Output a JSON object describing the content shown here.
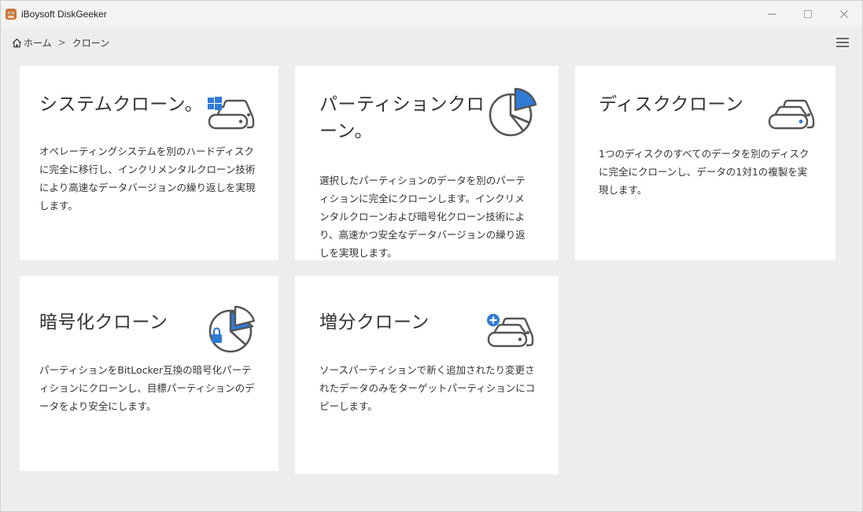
{
  "window": {
    "title": "iBoysoft DiskGeeker"
  },
  "breadcrumb": {
    "home": "ホーム",
    "separator": ">",
    "current": "クローン"
  },
  "colors": {
    "accent": "#2f7bd6",
    "icon_stroke": "#555555"
  },
  "cards": [
    {
      "title": "システムクローン。",
      "description": "オペレーティングシステムを別のハードディスクに完全に移行し、インクリメンタルクローン技術により高速なデータバージョンの繰り返しを実現します。",
      "icon": "windows-disk-icon"
    },
    {
      "title": "パーティションクローン。",
      "description": "選択したパーティションのデータを別のパーティションに完全にクローンします。インクリメンタルクローンおよび暗号化クローン技術により、高速かつ安全なデータバージョンの繰り返しを実現します。",
      "icon": "partition-pie-icon"
    },
    {
      "title": "ディスククローン",
      "description": "1つのディスクのすべてのデータを別のディスクに完全にクローンし、データの1対1の複製を実現します。",
      "icon": "disk-clone-icon"
    },
    {
      "title": "暗号化クローン",
      "description": "パーティションをBitLocker互換の暗号化パーティションにクローンし、目標パーティションのデータをより安全にします。",
      "icon": "encrypted-partition-icon"
    },
    {
      "title": "増分クローン",
      "description": "ソースパーティションで新く追加されたり変更されたデータのみをターゲットパーティションにコピーします。",
      "icon": "incremental-disk-icon"
    }
  ]
}
